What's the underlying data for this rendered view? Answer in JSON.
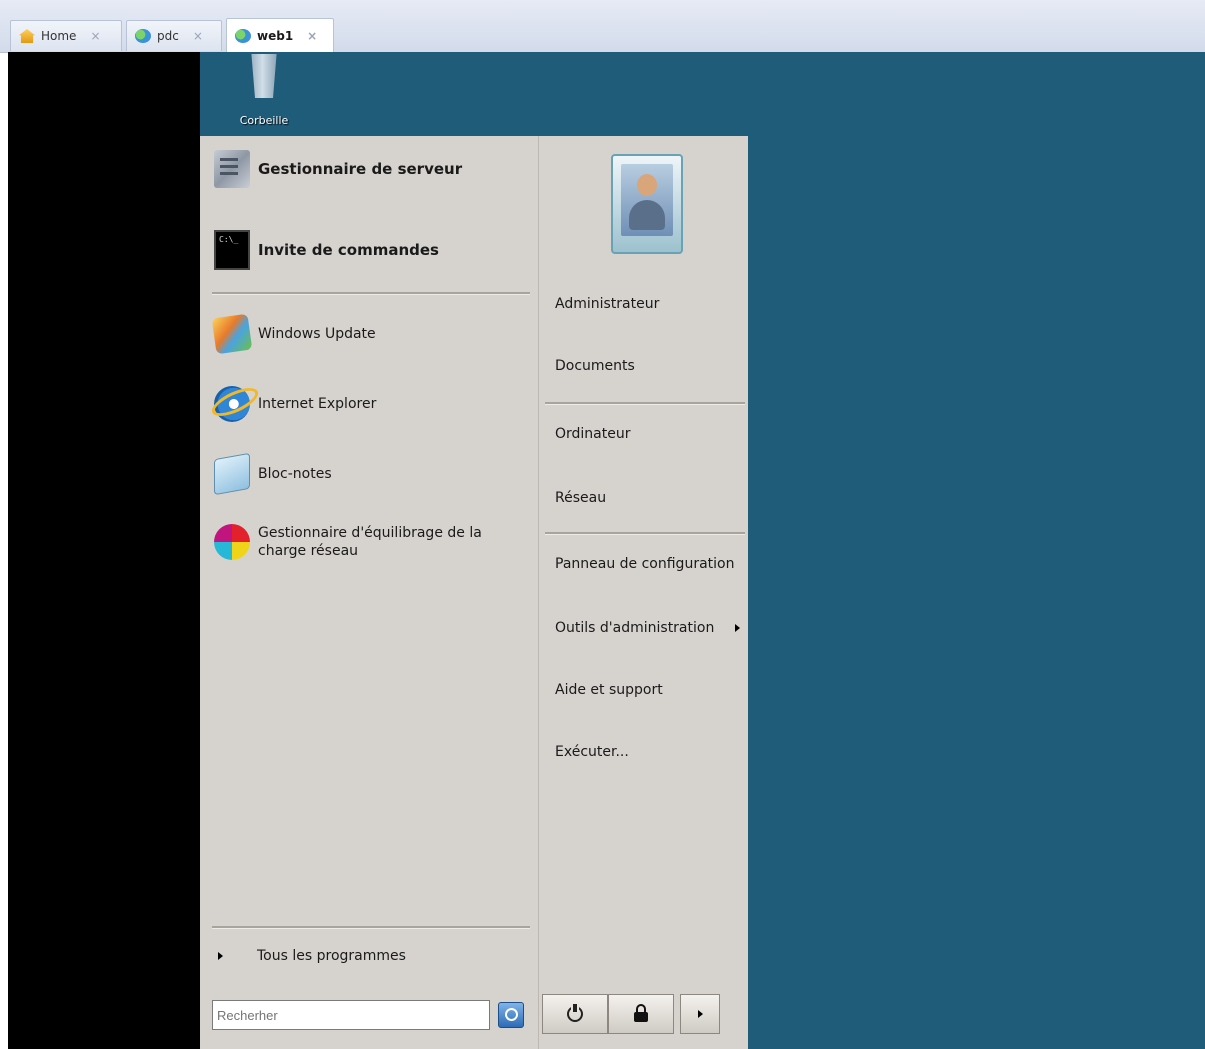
{
  "tabs": [
    {
      "label": "Home",
      "icon": "home-icon",
      "active": false
    },
    {
      "label": "pdc",
      "icon": "vm-icon",
      "active": false
    },
    {
      "label": "web1",
      "icon": "vm-icon",
      "active": true
    }
  ],
  "tab_close_glyph": "×",
  "desktop": {
    "recycle_bin_label": "Corbeille",
    "background_color": "#1f5c7a"
  },
  "start_menu": {
    "pinned": [
      {
        "label": "Gestionnaire de serveur",
        "icon": "server-manager-icon"
      },
      {
        "label": "Invite de commandes",
        "icon": "command-prompt-icon"
      }
    ],
    "recent": [
      {
        "label": "Windows Update",
        "icon": "windows-update-icon"
      },
      {
        "label": "Internet Explorer",
        "icon": "internet-explorer-icon"
      },
      {
        "label": "Bloc-notes",
        "icon": "notepad-icon"
      },
      {
        "label": "Gestionnaire d'équilibrage de la charge réseau",
        "icon": "network-load-balancing-icon"
      }
    ],
    "all_programs_label": "Tous les programmes",
    "search_placeholder": "Recherher",
    "right_items": [
      {
        "label": "Administrateur"
      },
      {
        "label": "Documents"
      },
      {
        "label": "Ordinateur"
      },
      {
        "label": "Réseau"
      },
      {
        "label": "Panneau de configuration"
      },
      {
        "label": "Outils d'administration",
        "has_submenu": true
      },
      {
        "label": "Aide et support"
      },
      {
        "label": "Exécuter..."
      }
    ],
    "power_buttons": [
      "power-icon",
      "lock-icon",
      "arrow-icon"
    ]
  },
  "colors": {
    "menu_bg": "#d6d3ce",
    "console_bg": "#000000",
    "tabbar_bg": "#dde3ef"
  }
}
